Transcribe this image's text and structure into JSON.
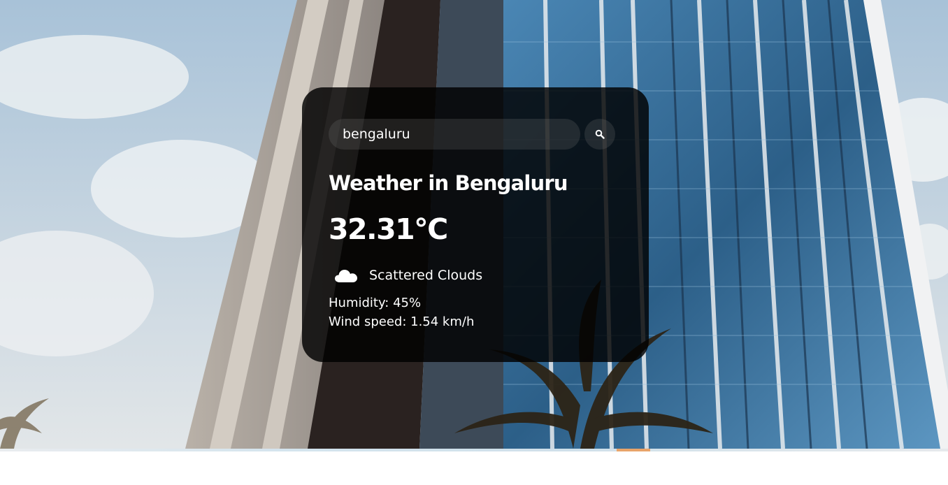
{
  "search": {
    "value": "bengaluru",
    "button_icon": "search-icon"
  },
  "weather": {
    "title": "Weather in Bengaluru",
    "temperature": "32.31°C",
    "condition_icon": "cloud-icon",
    "description": "Scattered Clouds",
    "humidity": "Humidity: 45%",
    "wind": "Wind speed: 1.54 km/h"
  },
  "colors": {
    "card_background": "#000000",
    "text": "#ffffff",
    "sky": "#a9c2d6",
    "glass": "#2f6f9e"
  }
}
